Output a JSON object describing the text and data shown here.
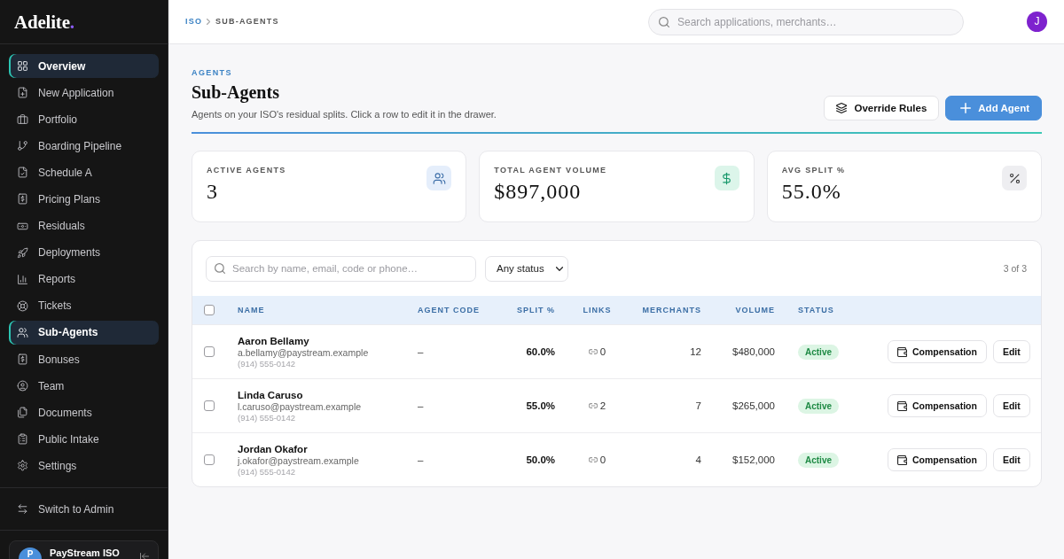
{
  "sidebar": {
    "logo": {
      "name": "Adelite",
      "mark": "."
    },
    "nav_items": [
      {
        "label": "Overview",
        "selected": true
      },
      {
        "label": "New Application",
        "selected": false
      },
      {
        "label": "Portfolio",
        "selected": false
      },
      {
        "label": "Boarding Pipeline",
        "selected": false
      },
      {
        "label": "Schedule A",
        "selected": false
      },
      {
        "label": "Pricing Plans",
        "selected": false
      },
      {
        "label": "Residuals",
        "selected": false
      },
      {
        "label": "Deployments",
        "selected": false
      },
      {
        "label": "Reports",
        "selected": false
      },
      {
        "label": "Tickets",
        "selected": false
      },
      {
        "label": "Sub-Agents",
        "selected": true
      },
      {
        "label": "Bonuses",
        "selected": false
      },
      {
        "label": "Team",
        "selected": false
      },
      {
        "label": "Documents",
        "selected": false
      },
      {
        "label": "Public Intake",
        "selected": false
      },
      {
        "label": "Settings",
        "selected": false
      }
    ],
    "switch_action": {
      "label": "Switch to Admin"
    },
    "org": {
      "avatar": "P",
      "name": "PayStream ISO"
    }
  },
  "header": {
    "breadcrumb": [
      {
        "label": "ISO",
        "current": false
      },
      {
        "label": "SUB-AGENTS",
        "current": true
      }
    ],
    "search": {
      "placeholder": "Search applications, merchants…"
    },
    "avatar": "J"
  },
  "page": {
    "eyebrow": "AGENTS",
    "title": "Sub-Agents",
    "subtitle": "Agents on your ISO's residual splits. Click a row to edit it in the drawer.",
    "actions": [
      {
        "label": "Override Rules",
        "kind": "secondary"
      },
      {
        "label": "Add Agent",
        "kind": "primary"
      }
    ]
  },
  "stats": [
    {
      "label": "ACTIVE AGENTS",
      "value": "3"
    },
    {
      "label": "TOTAL AGENT VOLUME",
      "value": "$897,000"
    },
    {
      "label": "AVG SPLIT %",
      "value": "55.0%"
    }
  ],
  "table": {
    "search": {
      "placeholder": "Search by name, email, code or phone…"
    },
    "status_filter": "Any status",
    "count": "3 of 3",
    "select_all_checked": false,
    "columns": [
      "NAME",
      "AGENT CODE",
      "SPLIT %",
      "LINKS",
      "MERCHANTS",
      "VOLUME",
      "STATUS"
    ],
    "rows": [
      {
        "checked": false,
        "name": "Aaron Bellamy",
        "email": "a.bellamy@paystream.example",
        "phone": "(914) 555-0142",
        "agent_code": "–",
        "split": "60.0%",
        "links": "0",
        "merchants": "12",
        "volume": "$480,000",
        "status": "Active",
        "actions": [
          {
            "label": "Compensation",
            "kind": "compensation"
          },
          {
            "label": "Edit",
            "kind": "edit"
          }
        ]
      },
      {
        "checked": false,
        "name": "Linda Caruso",
        "email": "l.caruso@paystream.example",
        "phone": "(914) 555-0142",
        "agent_code": "–",
        "split": "55.0%",
        "links": "2",
        "merchants": "7",
        "volume": "$265,000",
        "status": "Active",
        "actions": [
          {
            "label": "Compensation",
            "kind": "compensation"
          },
          {
            "label": "Edit",
            "kind": "edit"
          }
        ]
      },
      {
        "checked": false,
        "name": "Jordan Okafor",
        "email": "j.okafor@paystream.example",
        "phone": "(914) 555-0142",
        "agent_code": "–",
        "split": "50.0%",
        "links": "0",
        "merchants": "4",
        "volume": "$152,000",
        "status": "Active",
        "actions": [
          {
            "label": "Compensation",
            "kind": "compensation"
          },
          {
            "label": "Edit",
            "kind": "edit"
          }
        ]
      }
    ]
  }
}
